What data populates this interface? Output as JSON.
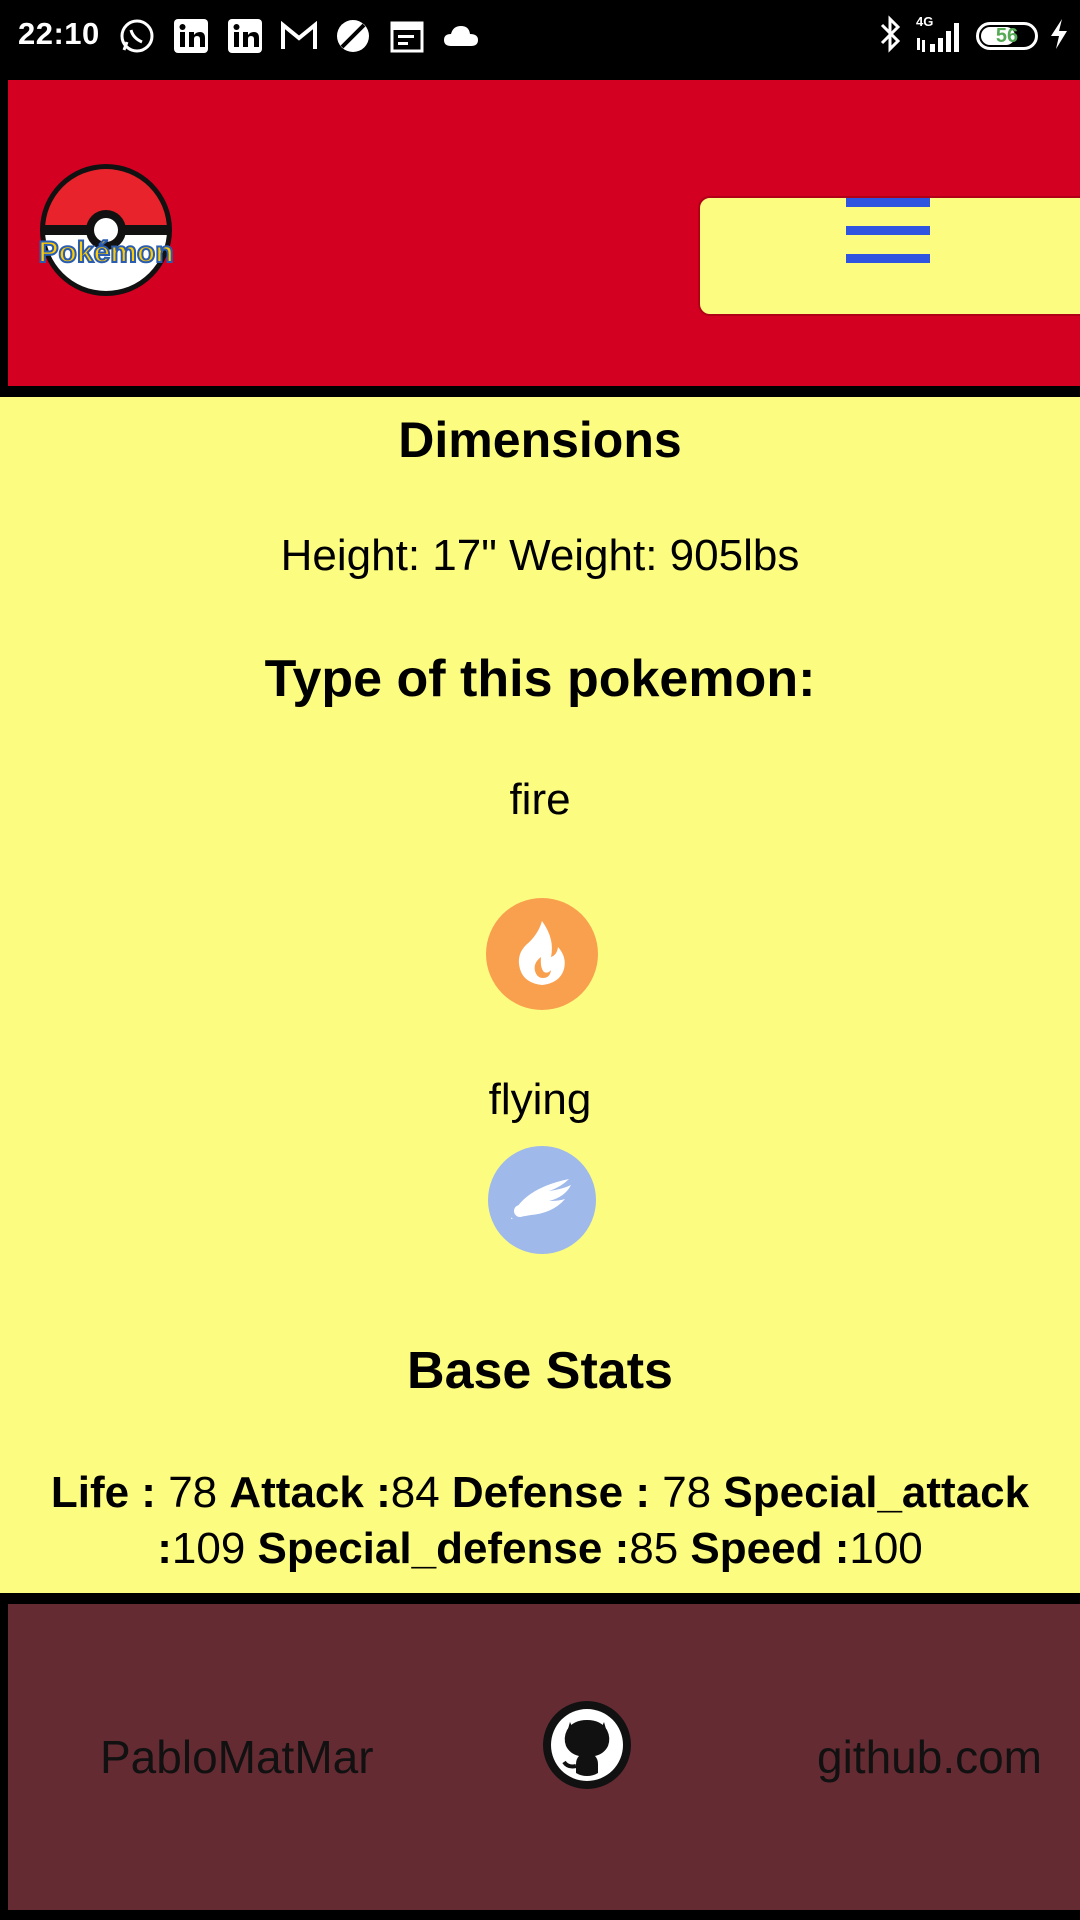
{
  "status_bar": {
    "time": "22:10",
    "battery": "56",
    "network": "4G",
    "left_icons": [
      "whatsapp-icon",
      "linkedin-icon",
      "linkedin-icon",
      "gmail-icon",
      "browser-icon",
      "calendar-icon",
      "cloud-icon"
    ],
    "right_icons": [
      "bluetooth-icon",
      "signal-icon",
      "battery-icon",
      "charging-icon"
    ]
  },
  "header": {
    "logo_text": "Pokémon",
    "menu_icon": "hamburger-icon",
    "colors": {
      "background": "#d40021",
      "menu_button": "#fcfc80",
      "menu_lines": "#2f55e0"
    }
  },
  "content": {
    "dimensions_title": "Dimensions",
    "dimensions_text": "Height: 17\" Weight: 905lbs",
    "type_title": "Type of this pokemon:",
    "types": [
      {
        "label": "fire",
        "icon": "fire-type-icon",
        "color": "#f9a04f"
      },
      {
        "label": "flying",
        "icon": "flying-type-icon",
        "color": "#9eb9ea"
      }
    ],
    "stats_title": "Base Stats",
    "stats": [
      {
        "label": "Life :",
        "value": " 78 "
      },
      {
        "label": "Attack :",
        "value": "84 "
      },
      {
        "label": "Defense :",
        "value": " 78 "
      },
      {
        "label": "Special_attack :",
        "value": "109 "
      },
      {
        "label": "Special_defense :",
        "value": "85 "
      },
      {
        "label": "Speed :",
        "value": "100"
      }
    ],
    "background": "#fcfc80"
  },
  "footer": {
    "author": "PabloMatMar",
    "link_text": "github.com",
    "icon": "github-icon",
    "background": "#652b33"
  }
}
